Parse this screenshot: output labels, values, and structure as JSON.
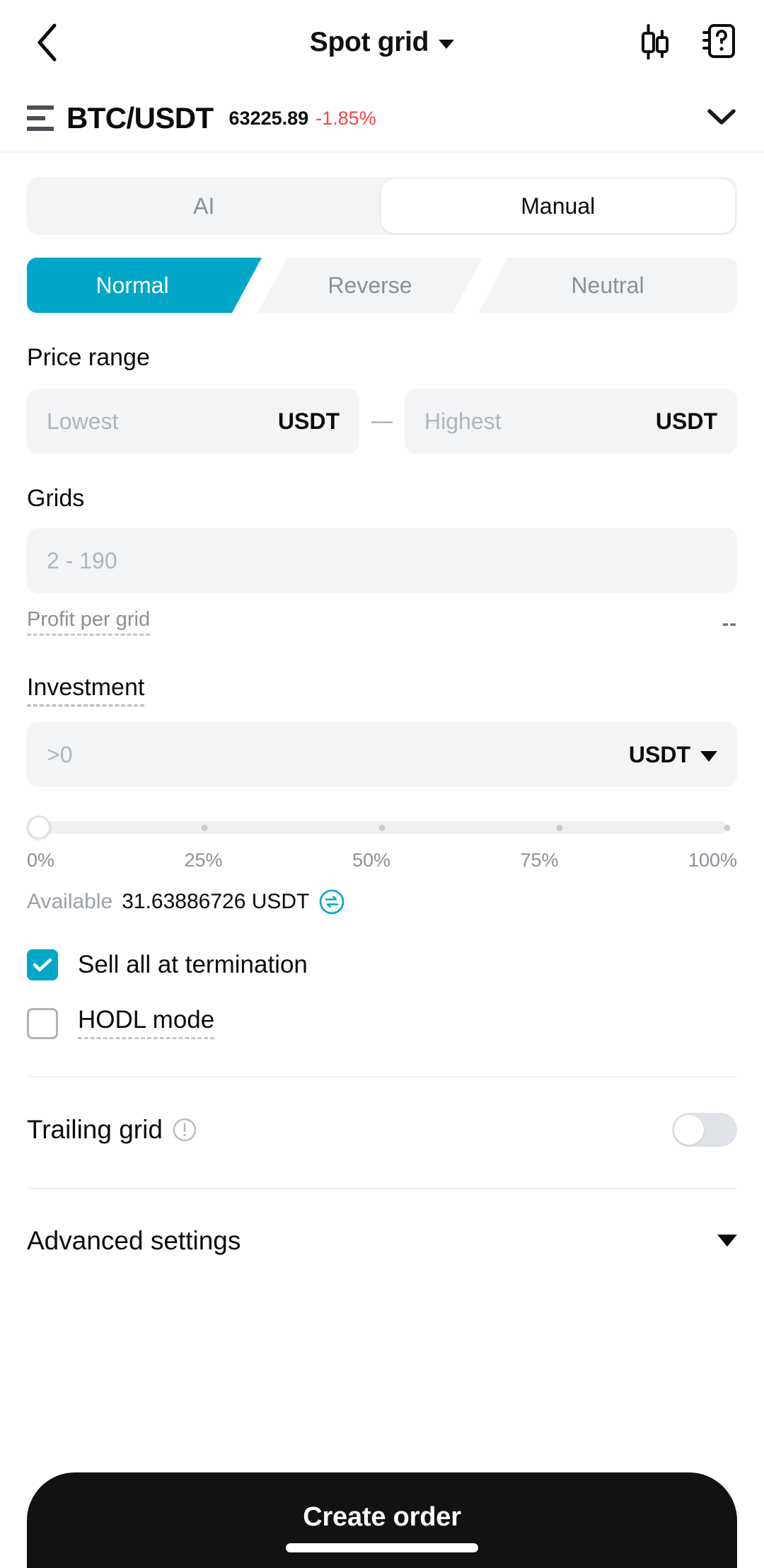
{
  "header": {
    "back_icon": "chevron-left-icon",
    "title": "Spot grid",
    "title_caret": "caret-down-icon",
    "chart_icon": "candlestick-chart-icon",
    "help_icon": "help-book-icon"
  },
  "pair": {
    "menu_icon": "hamburger-menu-icon",
    "symbol": "BTC/USDT",
    "price": "63225.89",
    "change": "-1.85%",
    "change_color": "#f0484b",
    "expand_icon": "chevron-down-icon"
  },
  "mode_segmented": {
    "options": [
      "AI",
      "Manual"
    ],
    "selected": "Manual"
  },
  "strategy_tabs": {
    "options": [
      "Normal",
      "Reverse",
      "Neutral"
    ],
    "selected": "Normal",
    "active_color": "#00a7c8"
  },
  "price_range": {
    "label": "Price range",
    "lowest_placeholder": "Lowest",
    "lowest_value": "",
    "lowest_unit": "USDT",
    "separator": "—",
    "highest_placeholder": "Highest",
    "highest_value": "",
    "highest_unit": "USDT"
  },
  "grids": {
    "label": "Grids",
    "placeholder": "2 - 190",
    "value": "",
    "profit_label": "Profit per grid",
    "profit_value": "--"
  },
  "investment": {
    "label": "Investment",
    "placeholder": ">0",
    "value": "",
    "unit": "USDT",
    "unit_caret": "caret-down-icon",
    "slider": {
      "value_percent": 0,
      "ticks": [
        "0%",
        "25%",
        "50%",
        "75%",
        "100%"
      ]
    },
    "available_label": "Available",
    "available_value": "31.63886726 USDT",
    "transfer_icon": "transfer-arrows-icon"
  },
  "options": [
    {
      "label": "Sell all at termination",
      "checked": true,
      "dashed": false
    },
    {
      "label": "HODL mode",
      "checked": false,
      "dashed": true
    }
  ],
  "trailing_grid": {
    "label": "Trailing grid",
    "info_icon": "info-circle-icon",
    "enabled": false
  },
  "advanced_settings": {
    "label": "Advanced settings",
    "caret": "caret-down-icon"
  },
  "cta": {
    "label": "Create order"
  }
}
